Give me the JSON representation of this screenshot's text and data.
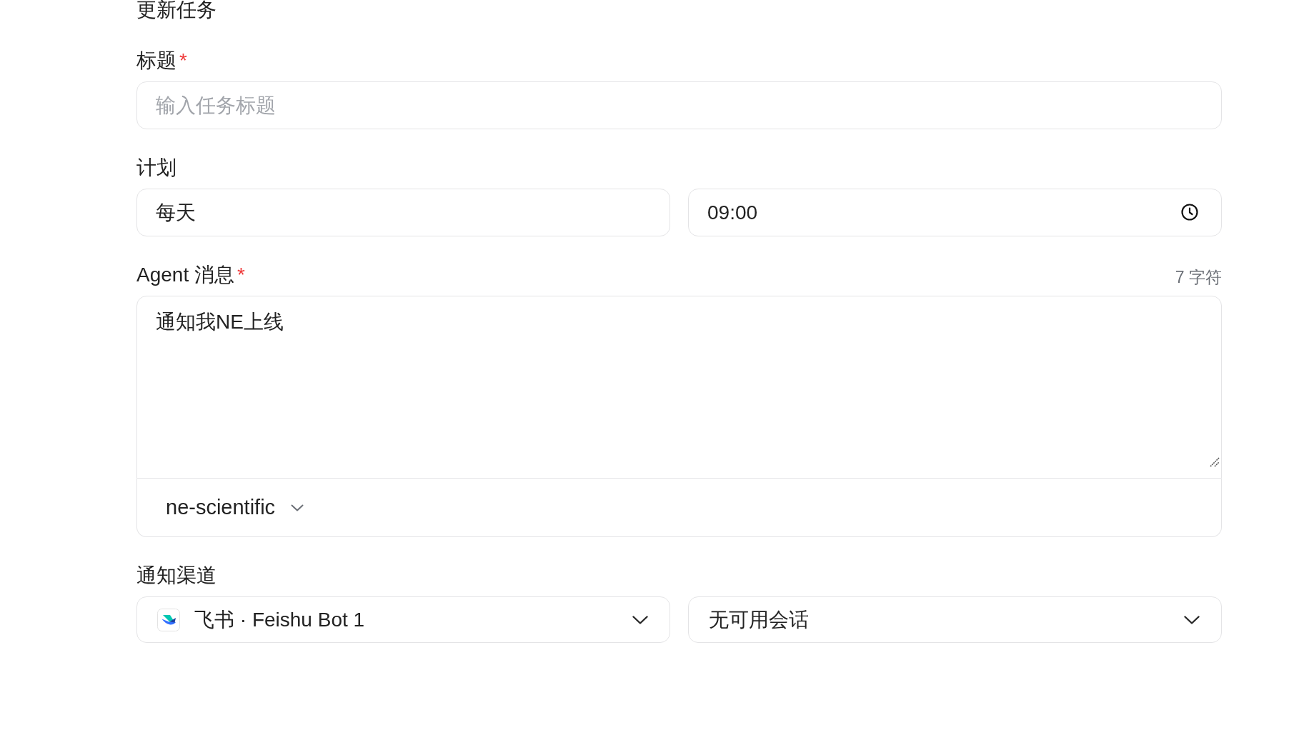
{
  "heading": "更新任务",
  "title_field": {
    "label": "标题",
    "mark": "*",
    "placeholder": "输入任务标题"
  },
  "schedule": {
    "label": "计划",
    "frequency": {
      "value": "每天"
    },
    "time": {
      "value": "09:00"
    }
  },
  "agent_message": {
    "label": "Agent 消息",
    "mark": "*",
    "counter": "7 字符",
    "value": "通知我NE上线",
    "agent_select": {
      "value": "ne-scientific"
    }
  },
  "channel": {
    "label": "通知渠道",
    "platform_select": {
      "value": "飞书 · Feishu Bot 1"
    },
    "session_select": {
      "value": "无可用会话"
    }
  }
}
